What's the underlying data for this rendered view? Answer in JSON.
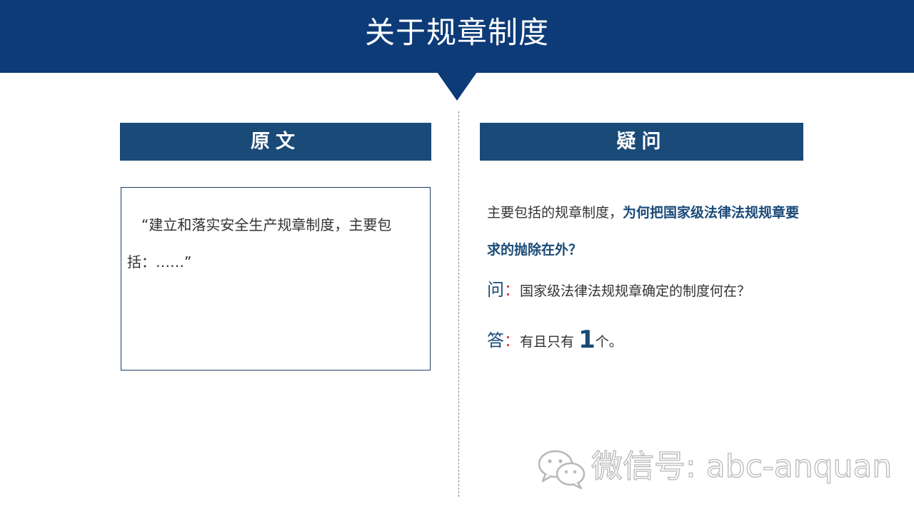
{
  "slide": {
    "title": "关于规章制度"
  },
  "left": {
    "header": "原文",
    "quote": "“建立和落实安全生产规章制度，主要包括：……”"
  },
  "right": {
    "header": "疑问",
    "question_plain": "主要包括的规章制度，",
    "question_emphasis": "为何把国家级法律法规规章要求的抛除在外？",
    "ask_mark": "问",
    "ask_colon": "：",
    "ask_text": "国家级法律法规规章确定的制度何在？",
    "answer_mark": "答",
    "answer_colon": "：",
    "answer_prefix": "有且只有",
    "answer_number": "1",
    "answer_suffix": "个。"
  },
  "watermark": {
    "icon": "wechat-icon",
    "text": "微信号: abc-anquan"
  },
  "colors": {
    "header_band": "#0d3b78",
    "section_header": "#1a4a78",
    "emphasis": "#1a4a78",
    "colon_accent": "#e0302e"
  }
}
